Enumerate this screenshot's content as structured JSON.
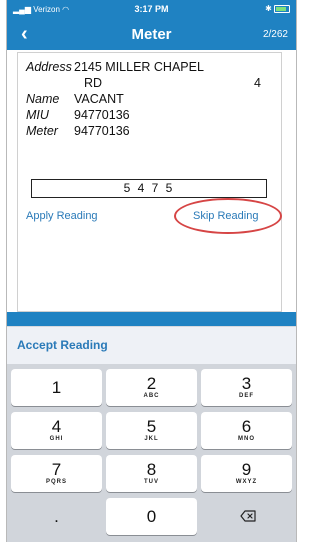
{
  "status_bar": {
    "carrier": "Verizon",
    "time": "3:17 PM"
  },
  "navbar": {
    "back_icon": "‹",
    "title": "Meter",
    "count": "2/262"
  },
  "info": {
    "address_label": "Address",
    "address_line1": "2145 MILLER CHAPEL",
    "address_line2": "RD",
    "address_unit": "4",
    "name_label": "Name",
    "name_value": "VACANT",
    "miu_label": "MIU",
    "miu_value": "94770136",
    "meter_label": "Meter",
    "meter_value": "94770136"
  },
  "reading": {
    "value": "5 4 7 5"
  },
  "actions": {
    "apply": "Apply Reading",
    "skip": "Skip Reading"
  },
  "accessory": {
    "accept": "Accept Reading"
  },
  "keypad": {
    "keys": [
      {
        "num": "1",
        "letters": ""
      },
      {
        "num": "2",
        "letters": "ABC"
      },
      {
        "num": "3",
        "letters": "DEF"
      },
      {
        "num": "4",
        "letters": "GHI"
      },
      {
        "num": "5",
        "letters": "JKL"
      },
      {
        "num": "6",
        "letters": "MNO"
      },
      {
        "num": "7",
        "letters": "PQRS"
      },
      {
        "num": "8",
        "letters": "TUV"
      },
      {
        "num": "9",
        "letters": "WXYZ"
      },
      {
        "num": ".",
        "letters": ""
      },
      {
        "num": "0",
        "letters": ""
      }
    ],
    "delete_icon": "backspace-icon"
  },
  "colors": {
    "header_blue": "#1f82c2",
    "link_blue": "#2a7ab8",
    "highlight_red": "#d64545"
  }
}
